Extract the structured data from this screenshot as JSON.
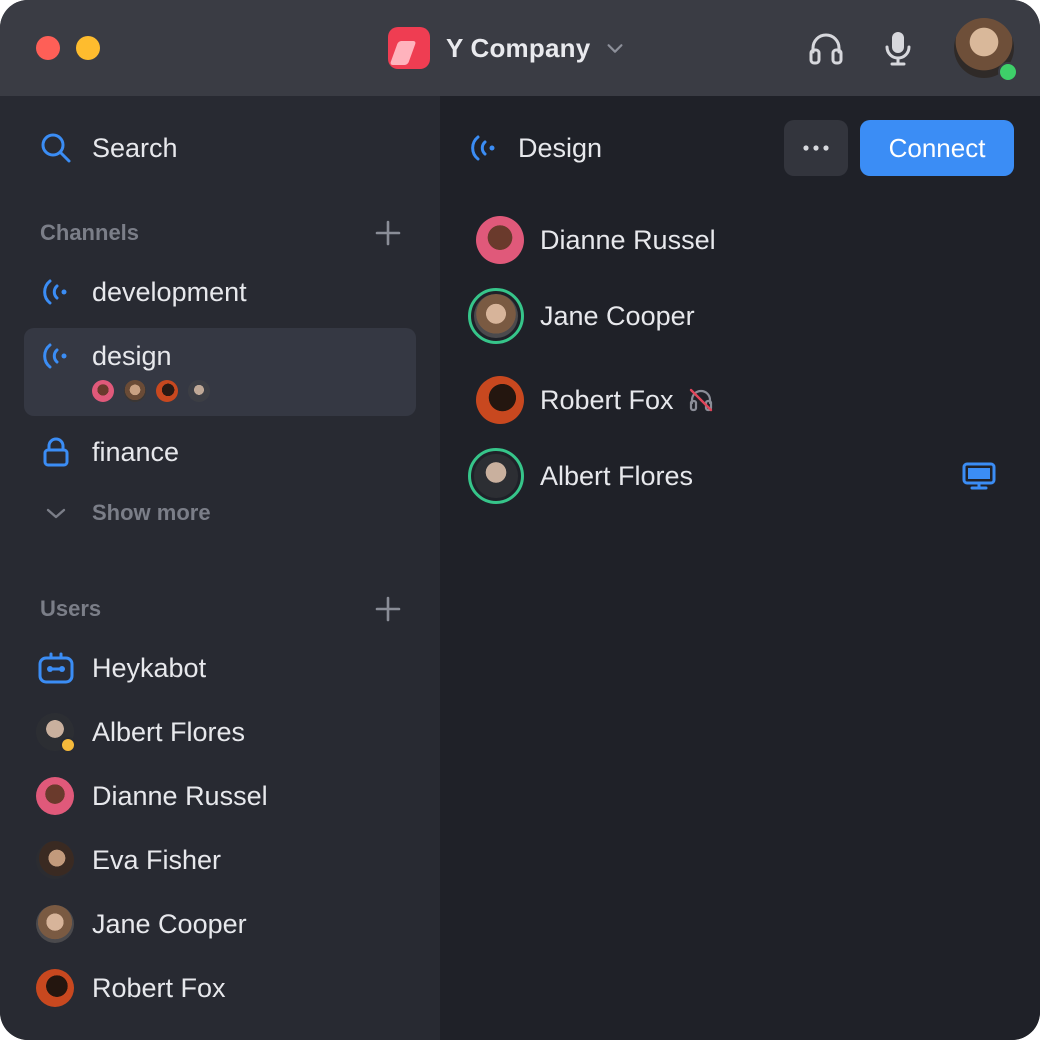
{
  "header": {
    "company": "Y Company",
    "colors": {
      "titlebar": "#3a3c44",
      "accent": "#3b8df5",
      "online": "#3ecf69",
      "speaking_ring": "#36c58a"
    },
    "icons": [
      "headphones-icon",
      "microphone-icon",
      "chevron-down-icon"
    ]
  },
  "sidebar": {
    "search_label": "Search",
    "channels_title": "Channels",
    "channels": [
      {
        "label": "development",
        "icon": "broadcast-icon"
      },
      {
        "label": "design",
        "icon": "broadcast-icon",
        "selected": true
      },
      {
        "label": "finance",
        "icon": "lock-icon"
      }
    ],
    "show_more": "Show more",
    "users_title": "Users",
    "users": [
      {
        "label": "Heykabot",
        "icon": "bot-icon"
      },
      {
        "label": "Albert Flores",
        "status": "away"
      },
      {
        "label": "Dianne Russel"
      },
      {
        "label": "Eva Fisher"
      },
      {
        "label": "Jane Cooper"
      },
      {
        "label": "Robert Fox"
      }
    ]
  },
  "main": {
    "channel_title": "Design",
    "connect_label": "Connect",
    "members": [
      {
        "name": "Dianne Russel",
        "speaking": false
      },
      {
        "name": "Jane Cooper",
        "speaking": true
      },
      {
        "name": "Robert Fox",
        "speaking": false,
        "deafened": true
      },
      {
        "name": "Albert Flores",
        "speaking": true,
        "screen_sharing": true
      }
    ]
  }
}
